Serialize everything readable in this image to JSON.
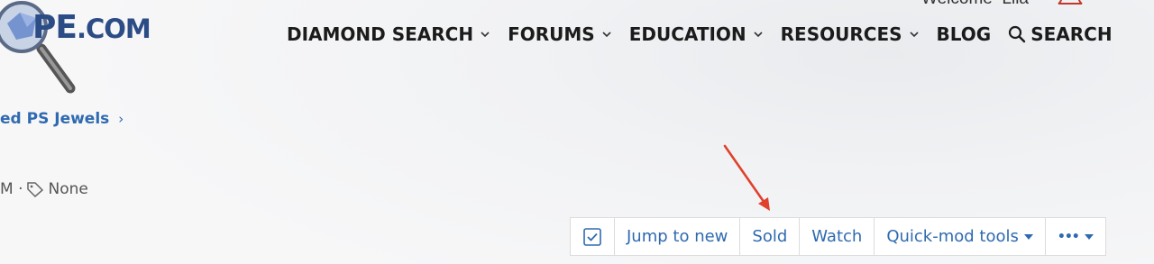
{
  "brand": {
    "logo_text": "PE",
    "logo_suffix": ".COM"
  },
  "header": {
    "welcome": "Welcome",
    "user": "Lila"
  },
  "nav": {
    "diamond_search": "DIAMOND SEARCH",
    "forums": "FORUMS",
    "education": "EDUCATION",
    "resources": "RESOURCES",
    "blog": "BLOG",
    "search": "SEARCH"
  },
  "breadcrumb": {
    "item": "ed PS Jewels",
    "chevron": "›"
  },
  "thread_meta": {
    "partial_time": "M ·",
    "tags": "None"
  },
  "toolbar": {
    "jump_to_new": "Jump to new",
    "sold": "Sold",
    "watch": "Watch",
    "quick_mod_tools": "Quick-mod tools",
    "more": "•••"
  },
  "colors": {
    "link": "#2f6ab0",
    "nav_text": "#1b1b1b",
    "annotation_arrow": "#e0412d"
  },
  "icons": [
    "magnifier-logo-icon",
    "chevron-down-icon",
    "search-icon",
    "tag-icon",
    "checkbox-icon",
    "caret-down-icon",
    "bell-icon"
  ]
}
